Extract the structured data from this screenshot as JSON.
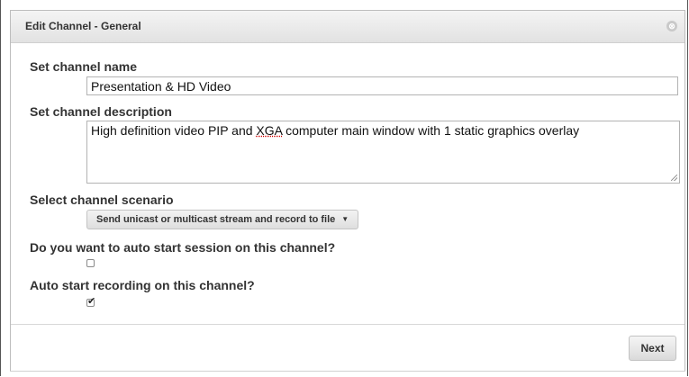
{
  "dialog": {
    "title": "Edit Channel - General",
    "close_glyph": "⊗"
  },
  "channel_name": {
    "label": "Set channel name",
    "value": "Presentation & HD Video"
  },
  "channel_description": {
    "label": "Set channel description",
    "value_before": "High definition video PIP and ",
    "value_misspelled": "XGA",
    "value_after": " computer main window with 1 static graphics overlay"
  },
  "scenario": {
    "label": "Select channel scenario",
    "selected": "Send unicast or multicast stream and record to file",
    "caret": "▼"
  },
  "auto_start_session": {
    "label": "Do you want to auto start session on this channel?",
    "checked": false
  },
  "auto_start_recording": {
    "label": "Auto start recording on this channel?",
    "checked": true,
    "checkmark": "✔"
  },
  "footer": {
    "next_label": "Next"
  }
}
